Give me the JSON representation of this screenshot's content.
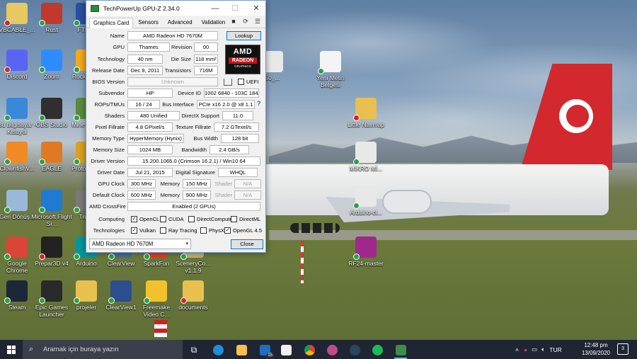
{
  "window": {
    "title": "TechPowerUp GPU-Z 2.34.0",
    "minimize": "—",
    "maximize": "☐",
    "close": "✕",
    "tabs": [
      "Graphics Card",
      "Sensors",
      "Advanced",
      "Validation"
    ]
  },
  "gpu": {
    "name_label": "Name",
    "name": "AMD Radeon HD 7670M",
    "lookup_button": "Lookup",
    "gpu_label": "GPU",
    "gpu": "Thames",
    "revision_label": "Revision",
    "revision": "00",
    "technology_label": "Technology",
    "technology": "40 nm",
    "die_size_label": "Die Size",
    "die_size": "118 mm²",
    "release_label": "Release Date",
    "release": "Dec 8, 2011",
    "transistors_label": "Transistors",
    "transistors": "716M",
    "bios_label": "BIOS Version",
    "bios": "Unknown",
    "uefi_label": "UEFI",
    "subvendor_label": "Subvendor",
    "subvendor": "HP",
    "device_id_label": "Device ID",
    "device_id": "1002 6840 - 103C 184A",
    "rops_label": "ROPs/TMUs",
    "rops": "16 / 24",
    "bus_label": "Bus Interface",
    "bus": "PCIe x16 2.0 @ x8 1.1",
    "help": "?",
    "shaders_label": "Shaders",
    "shaders": "480 Unified",
    "directx_label": "DirectX Support",
    "directx": "11.0",
    "pixel_label": "Pixel Fillrate",
    "pixel": "4.8 GPixel/s",
    "texture_label": "Texture Fillrate",
    "texture": "7.2 GTexel/s",
    "memtype_label": "Memory Type",
    "memtype": "HyperMemory (Hynix)",
    "buswidth_label": "Bus Width",
    "buswidth": "128 bit",
    "memsize_label": "Memory Size",
    "memsize": "1024 MB",
    "bandwidth_label": "Bandwidth",
    "bandwidth": "2.4 GB/s",
    "driver_label": "Driver Version",
    "driver": "15.200.1065.0 (Crimson 16.2.1) / Win10 64",
    "driverdate_label": "Driver Date",
    "driverdate": "Jul 21, 2015",
    "signature_label": "Digital Signature",
    "signature": "WHQL",
    "gpuclock_label": "GPU Clock",
    "gpuclock": "300 MHz",
    "memory_label": "Memory",
    "memclock": "150 MHz",
    "shader_label": "Shader",
    "shader": "N/A",
    "defclock_label": "Default Clock",
    "defclock": "600 MHz",
    "defmem": "900 MHz",
    "defshader": "N/A",
    "crossfire_label": "AMD CrossFire",
    "crossfire": "Enabled (2 GPUs)",
    "computing_label": "Computing",
    "technologies_label": "Technologies",
    "computing": [
      {
        "label": "OpenCL",
        "checked": true
      },
      {
        "label": "CUDA",
        "checked": false
      },
      {
        "label": "DirectCompute",
        "checked": false
      },
      {
        "label": "DirectML",
        "checked": false
      }
    ],
    "technologies": [
      {
        "label": "Vulkan",
        "checked": true
      },
      {
        "label": "Ray Tracing",
        "checked": false
      },
      {
        "label": "PhysX",
        "checked": false
      },
      {
        "label": "OpenGL 4.5",
        "checked": true
      }
    ],
    "selected_card": "AMD Radeon HD 7670M",
    "close_button": "Close",
    "logo": {
      "brand": "AMD",
      "line": "RADEON",
      "sub": "GRAPHICS"
    }
  },
  "desktop_icons": [
    {
      "label": "VBCABLE_...",
      "color": "#e8c860",
      "badge": "err"
    },
    {
      "label": "Rust",
      "color": "#c0392b",
      "badge": "ok"
    },
    {
      "label": "FTK G",
      "color": "#2b4f9e",
      "badge": "ok"
    },
    {
      "label": "Discord",
      "color": "#5865f2",
      "badge": "err"
    },
    {
      "label": "Zoom",
      "color": "#2d8cff",
      "badge": "ok"
    },
    {
      "label": "Rock Gam",
      "color": "#f1a81b",
      "badge": "ok"
    },
    {
      "label": "Bu bilgisayar - Kısayol",
      "color": "#3a88d8",
      "badge": "ok"
    },
    {
      "label": "OBS Studio",
      "color": "#302e31",
      "badge": "ok"
    },
    {
      "label": "Mine Team",
      "color": "#5b8a3c",
      "badge": "ok"
    },
    {
      "label": "ClownfishV...",
      "color": "#f08a24",
      "badge": "ok"
    },
    {
      "label": "EAGLE",
      "color": "#e07a22",
      "badge": "ok"
    },
    {
      "label": "Proto Simu",
      "color": "#d8a020",
      "badge": "ok"
    },
    {
      "label": "Geri Dönüş...",
      "color": "#9ab8d8",
      "badge": "ok"
    },
    {
      "label": "Microsoft Flight Si...",
      "color": "#1f7ad1",
      "badge": "ok"
    },
    {
      "label": "Truck",
      "color": "#7a7a7a",
      "badge": "ok"
    },
    {
      "label": "Google Chrome",
      "color": "#db4437",
      "badge": "ok"
    },
    {
      "label": "Prepar3D v4",
      "color": "#222222",
      "badge": "err"
    },
    {
      "label": "Arduino",
      "color": "#00979c",
      "badge": "ok"
    },
    {
      "label": "ClearView",
      "color": "#4a6a8a",
      "badge": "ok"
    },
    {
      "label": "SparkFun",
      "color": "#e03a2a",
      "badge": "ok"
    },
    {
      "label": "SceneryCo... v1.1.9",
      "color": "#c0b070",
      "badge": "ok"
    },
    {
      "label": "Steam",
      "color": "#1b2838",
      "badge": "ok"
    },
    {
      "label": "Epic Games Launcher",
      "color": "#2a2a2a",
      "badge": "ok"
    },
    {
      "label": "projeler",
      "color": "#e8c050",
      "badge": "ok"
    },
    {
      "label": "ClearView1",
      "color": "#2c4d90",
      "badge": "ok"
    },
    {
      "label": "Freemake Video C...",
      "color": "#f2c12e",
      "badge": "ok"
    },
    {
      "label": "documents",
      "color": "#e8c050",
      "badge": "err"
    },
    {
      "label": "Yeni Metin Belgesi",
      "color": "#f4f4f4",
      "badge": "ok"
    },
    {
      "label": "Little Navmap",
      "color": "#e8c050",
      "badge": "err"
    },
    {
      "label": "MİKRO Mİ...",
      "color": "#e8e8e8",
      "badge": "ok"
    },
    {
      "label": "Arduino-cl...",
      "color": "#e8e8e8",
      "badge": "ok"
    },
    {
      "label": "RF24-master",
      "color": "#a0288c",
      "badge": "ok"
    },
    {
      "label": "50_...",
      "color": "#e8e8e8",
      "badge": "ok"
    }
  ],
  "taskbar": {
    "search_placeholder": "Aramak için buraya yazın",
    "mail_count": "15",
    "language": "TUR",
    "time": "12:48 pm",
    "date": "13/09/2020",
    "notifications": "3"
  }
}
